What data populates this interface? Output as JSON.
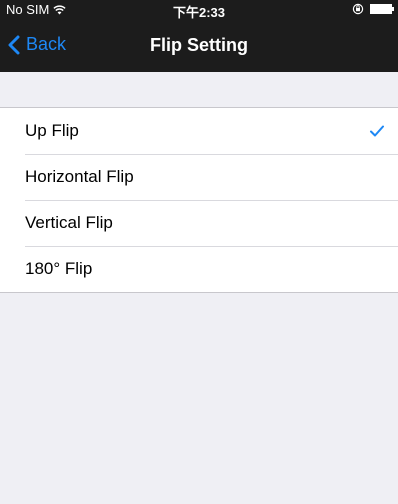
{
  "status_bar": {
    "carrier": "No SIM",
    "time": "下午2:33"
  },
  "nav": {
    "back_label": "Back",
    "title": "Flip Setting"
  },
  "options": [
    {
      "label": "Up Flip",
      "selected": true
    },
    {
      "label": "Horizontal Flip",
      "selected": false
    },
    {
      "label": "Vertical Flip",
      "selected": false
    },
    {
      "label": "180° Flip",
      "selected": false
    }
  ],
  "colors": {
    "accent": "#1e88f5",
    "bar_background": "#1c1c1c",
    "page_background": "#efeff4"
  },
  "icons": {
    "wifi": "wifi-icon",
    "lock_rotation": "rotation-lock-icon",
    "battery": "battery-icon",
    "back": "chevron-left-icon",
    "selected": "checkmark-icon"
  }
}
